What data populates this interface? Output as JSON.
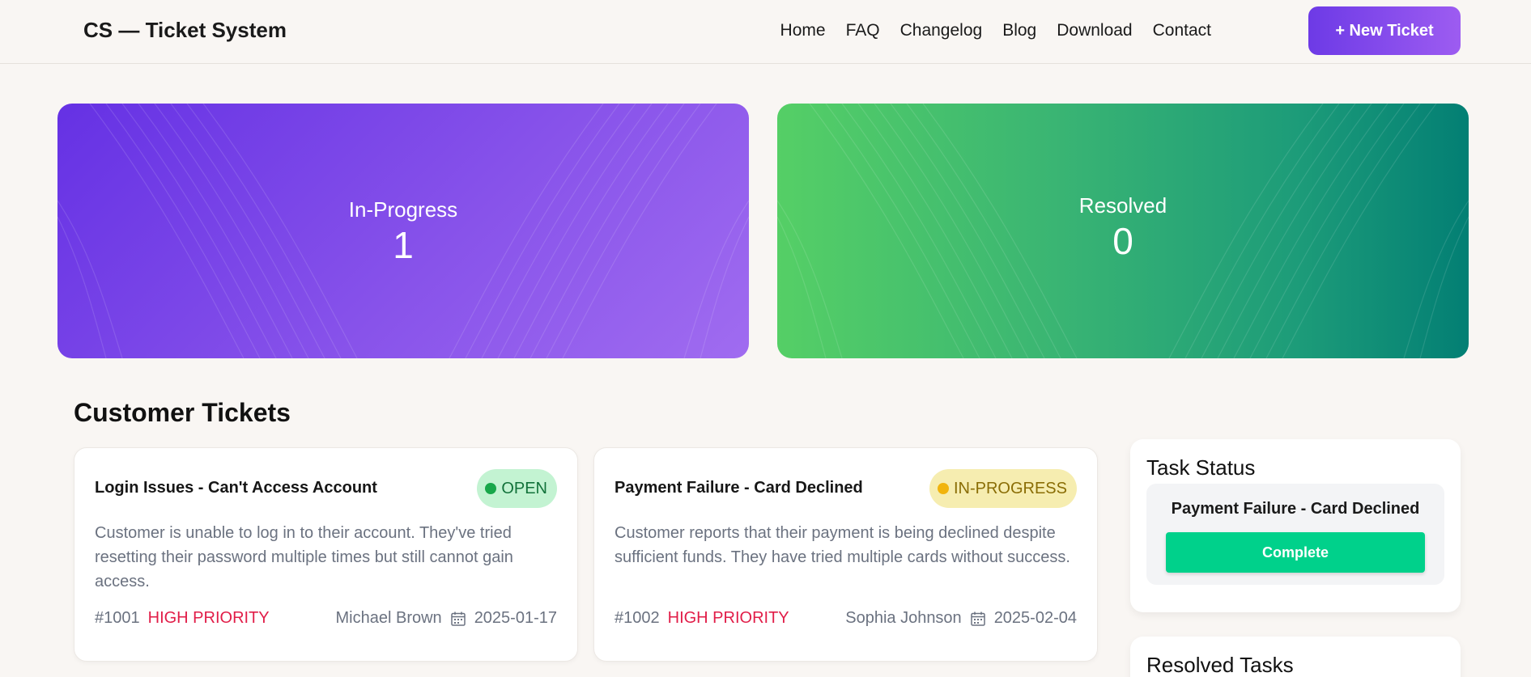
{
  "navbar": {
    "brand": "CS — Ticket System",
    "links": [
      "Home",
      "FAQ",
      "Changelog",
      "Blog",
      "Download",
      "Contact"
    ],
    "new_ticket_label": "+ New Ticket"
  },
  "stats": {
    "in_progress": {
      "label": "In-Progress",
      "value": "1"
    },
    "resolved": {
      "label": "Resolved",
      "value": "0"
    }
  },
  "section_title": "Customer Tickets",
  "tickets": [
    {
      "title": "Login Issues - Can't Access Account",
      "status": "OPEN",
      "description": "Customer is unable to log in to their account. They've tried resetting their password multiple times but still cannot gain access.",
      "id": "#1001",
      "priority": "HIGH PRIORITY",
      "customer": "Michael Brown",
      "date": "2025-01-17"
    },
    {
      "title": "Payment Failure - Card Declined",
      "status": "IN-PROGRESS",
      "description": "Customer reports that their payment is being declined despite sufficient funds. They have tried multiple cards without success.",
      "id": "#1002",
      "priority": "HIGH PRIORITY",
      "customer": "Sophia Johnson",
      "date": "2025-02-04"
    }
  ],
  "task_status": {
    "title": "Task Status",
    "task_name": "Payment Failure - Card Declined",
    "complete_label": "Complete"
  },
  "resolved_tasks": {
    "title": "Resolved Tasks"
  },
  "colors": {
    "accent": "#6d3ae6",
    "success": "#00d18b",
    "priority_high": "#e11d48"
  }
}
